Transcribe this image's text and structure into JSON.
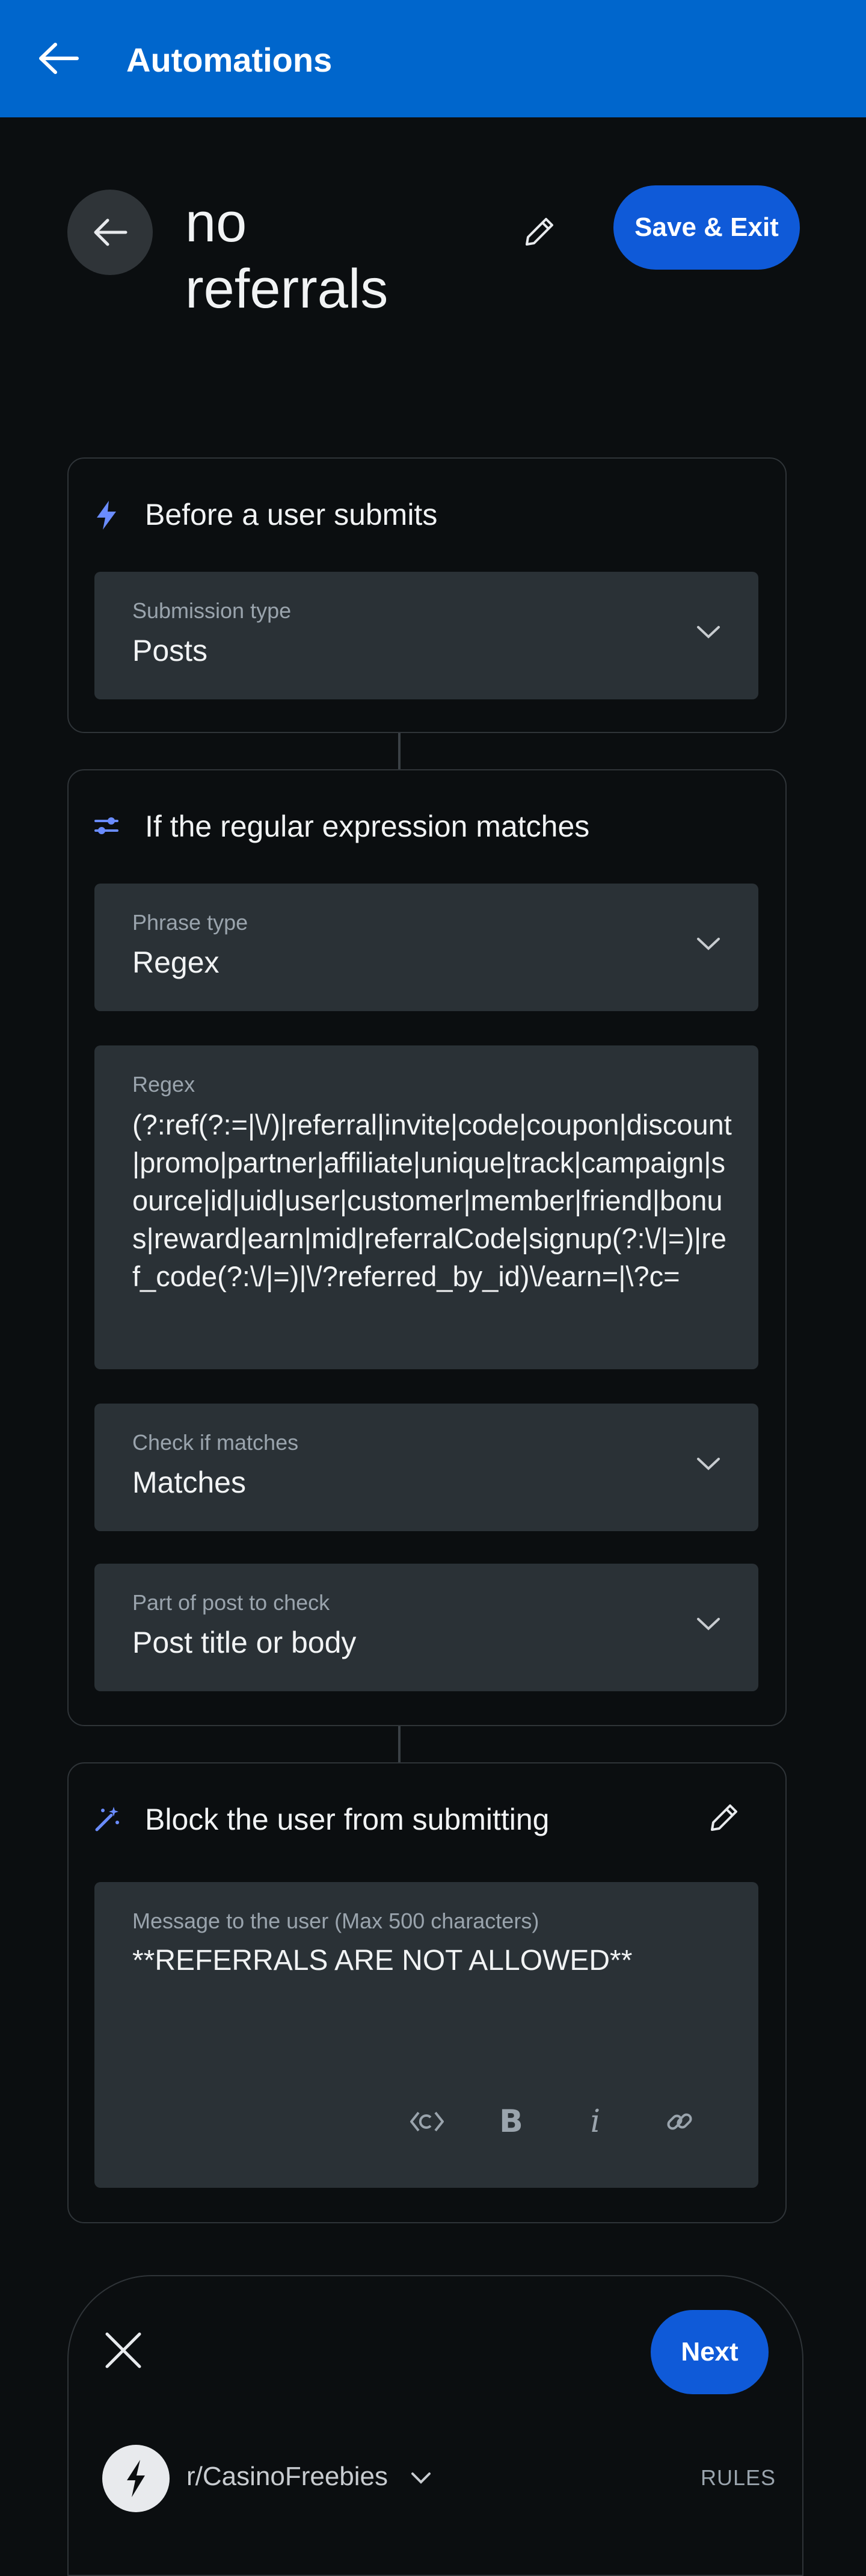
{
  "topbar": {
    "title": "Automations",
    "back_icon": "arrow-left-icon"
  },
  "header": {
    "rule_name": "no referrals",
    "save_exit_label": "Save & Exit"
  },
  "trigger": {
    "heading": "Before a user submits",
    "submission_type": {
      "label": "Submission type",
      "value": "Posts"
    }
  },
  "condition": {
    "heading": "If the regular expression matches",
    "phrase_type": {
      "label": "Phrase type",
      "value": "Regex"
    },
    "regex": {
      "label": "Regex",
      "value": "(?:ref(?:=|\\/)|referral|invite|code|coupon|discount|promo|partner|affiliate|unique|track|campaign|source|id|uid|user|customer|member|friend|bonus|reward|earn|mid|referralCode|signup(?:\\/|=)|ref_code(?:\\/|=)|\\/?referred_by_id)\\/earn=|\\?c="
    },
    "check_if": {
      "label": "Check if matches",
      "value": "Matches"
    },
    "part_to_check": {
      "label": "Part of post to check",
      "value": "Post title or body"
    }
  },
  "action": {
    "heading": "Block the user from submitting",
    "message": {
      "label": "Message to the user (Max 500 characters)",
      "value": "**REFERRALS ARE NOT ALLOWED**"
    }
  },
  "footer": {
    "next_label": "Next",
    "subreddit": "r/CasinoFreebies",
    "rules_label": "RULES"
  },
  "colors": {
    "topbar": "#0066cc",
    "primary_button": "#0f5ad8",
    "background": "#0b0e10",
    "field": "#2a3136",
    "accent_icon": "#6a8cff"
  }
}
